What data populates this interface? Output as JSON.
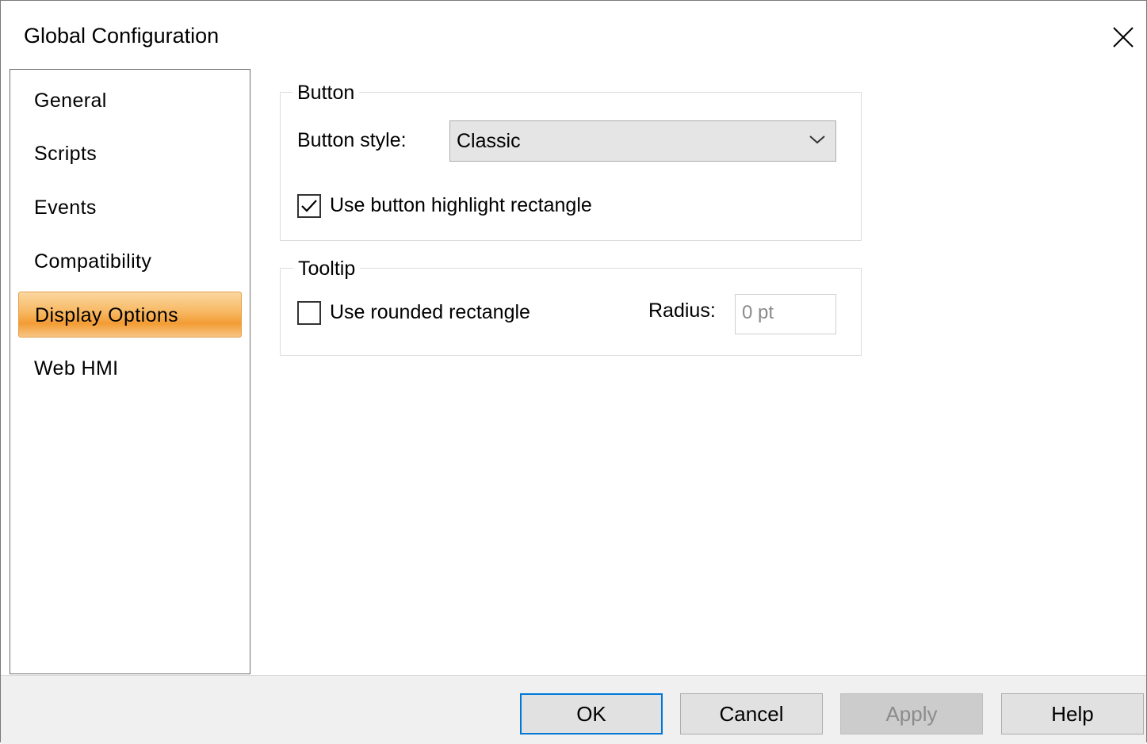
{
  "window": {
    "title": "Global Configuration"
  },
  "nav": {
    "items": [
      {
        "label": "General"
      },
      {
        "label": "Scripts"
      },
      {
        "label": "Events"
      },
      {
        "label": "Compatibility"
      },
      {
        "label": "Display Options",
        "selected": true
      },
      {
        "label": "Web HMI"
      }
    ]
  },
  "button_group": {
    "title": "Button",
    "style_label": "Button style:",
    "style_value": "Classic",
    "highlight_label": "Use button highlight rectangle",
    "highlight_checked": true
  },
  "tooltip_group": {
    "title": "Tooltip",
    "rounded_label": "Use rounded rectangle",
    "rounded_checked": false,
    "radius_label": "Radius:",
    "radius_value": "0 pt"
  },
  "footer": {
    "ok": "OK",
    "cancel": "Cancel",
    "apply": "Apply",
    "help": "Help"
  },
  "colors": {
    "selected_item": "#f7b761",
    "default_button_border": "#0078d7"
  }
}
